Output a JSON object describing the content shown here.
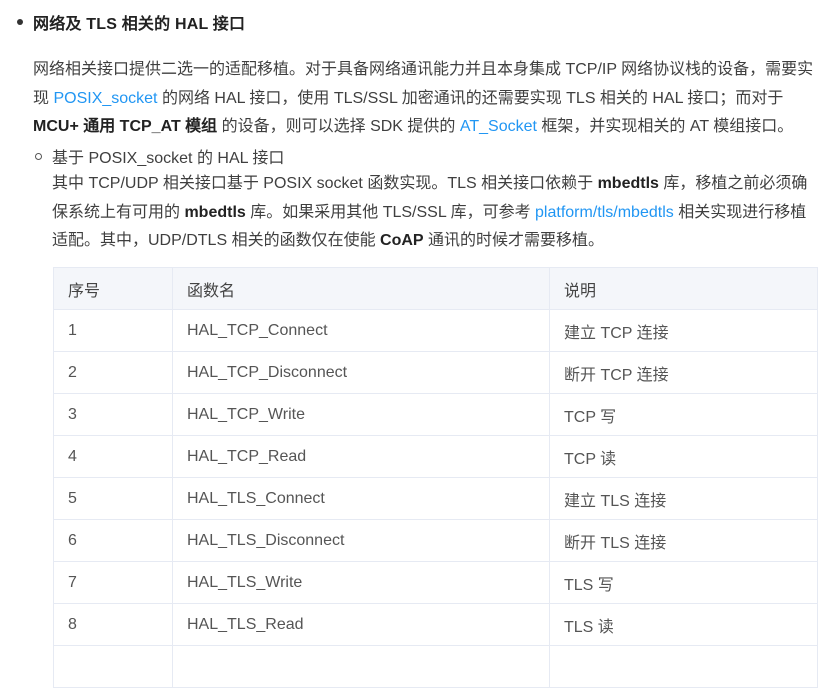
{
  "section": {
    "title": "网络及 TLS 相关的 HAL 接口",
    "intro": {
      "t1": "网络相关接口提供二选一的适配移植。对于具备网络通讯能力并且本身集成 TCP/IP 网络协议栈的设备，需要实现 ",
      "link1": "POSIX_socket",
      "t2": " 的网络 HAL 接口，使用 TLS/SSL 加密通讯的还需要实现 TLS 相关的 HAL 接口；而对于 ",
      "b1": "MCU+ 通用 TCP_AT 模组",
      "t3": " 的设备，则可以选择 SDK 提供的 ",
      "link2": "AT_Socket",
      "t4": " 框架，并实现相关的 AT 模组接口。"
    },
    "subsection": {
      "title": "基于 POSIX_socket 的 HAL 接口",
      "t1": "其中 TCP/UDP 相关接口基于 POSIX socket 函数实现。TLS 相关接口依赖于 ",
      "b1": "mbedtls",
      "t2": " 库，移植之前必须确保系统上有可用的 ",
      "b2": "mbedtls",
      "t3": " 库。如果采用其他 TLS/SSL 库，可参考 ",
      "link1": "platform/tls/mbedtls",
      "t4": " 相关实现进行移植适配。其中，UDP/DTLS 相关的函数仅在使能 ",
      "b3": "CoAP",
      "t5": " 通讯的时候才需要移植。"
    }
  },
  "table": {
    "headers": [
      "序号",
      "函数名",
      "说明"
    ],
    "rows": [
      [
        "1",
        "HAL_TCP_Connect",
        "建立 TCP 连接"
      ],
      [
        "2",
        "HAL_TCP_Disconnect",
        "断开 TCP 连接"
      ],
      [
        "3",
        "HAL_TCP_Write",
        "TCP 写"
      ],
      [
        "4",
        "HAL_TCP_Read",
        "TCP 读"
      ],
      [
        "5",
        "HAL_TLS_Connect",
        "建立 TLS 连接"
      ],
      [
        "6",
        "HAL_TLS_Disconnect",
        "断开 TLS 连接"
      ],
      [
        "7",
        "HAL_TLS_Write",
        "TLS 写"
      ],
      [
        "8",
        "HAL_TLS_Read",
        "TLS 读"
      ],
      [
        "",
        "",
        ""
      ]
    ]
  },
  "colors": {
    "link": "#2196f3",
    "table_border": "#e6eaf3",
    "table_header_bg": "#f4f6fa"
  }
}
